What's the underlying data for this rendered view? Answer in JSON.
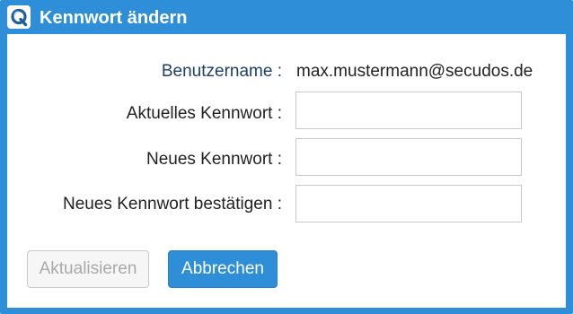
{
  "window": {
    "title": "Kennwort ändern",
    "icon": "app-q-icon",
    "accent_color": "#2e8fd8"
  },
  "form": {
    "username_label": "Benutzername :",
    "username_value": "max.mustermann@secudos.de",
    "current_password_label": "Aktuelles Kennwort :",
    "current_password_value": "",
    "new_password_label": "Neues Kennwort :",
    "new_password_value": "",
    "confirm_password_label": "Neues Kennwort bestätigen :",
    "confirm_password_value": ""
  },
  "buttons": {
    "update_label": "Aktualisieren",
    "update_enabled": false,
    "cancel_label": "Abbrechen"
  }
}
